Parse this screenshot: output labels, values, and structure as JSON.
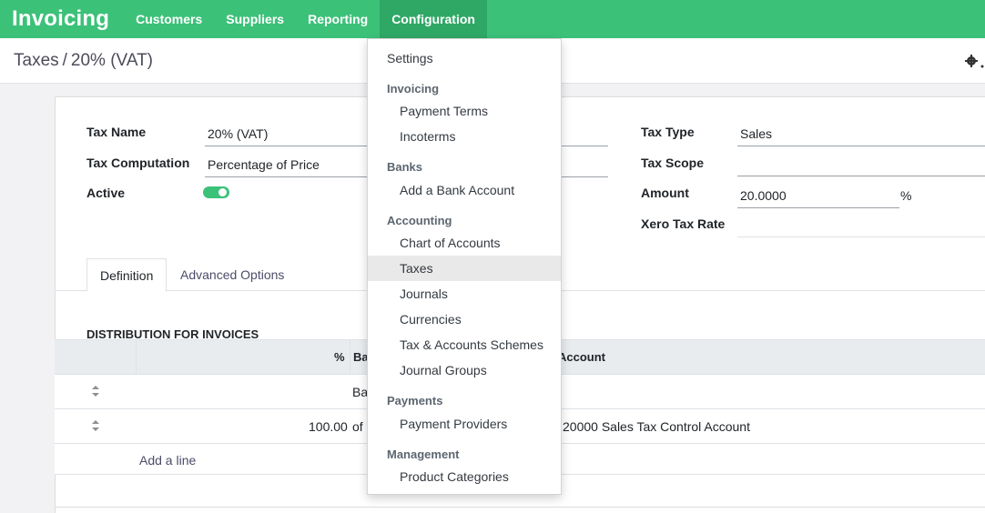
{
  "navbar": {
    "brand": "Invoicing",
    "items": [
      "Customers",
      "Suppliers",
      "Reporting",
      "Configuration"
    ]
  },
  "breadcrumb": {
    "parent": "Taxes",
    "separator": "/",
    "current": "20% (VAT)"
  },
  "form": {
    "tax_name_label": "Tax Name",
    "tax_name_value": "20% (VAT)",
    "tax_computation_label": "Tax Computation",
    "tax_computation_value": "Percentage of Price",
    "active_label": "Active",
    "tax_type_label": "Tax Type",
    "tax_type_value": "Sales",
    "tax_scope_label": "Tax Scope",
    "amount_label": "Amount",
    "amount_value": "20.0000",
    "amount_unit": "%",
    "xero_label": "Xero Tax Rate"
  },
  "tabs": {
    "definition": "Definition",
    "advanced": "Advanced Options"
  },
  "distribution": {
    "title": "DISTRIBUTION FOR INVOICES",
    "col_percent": "%",
    "col_base": "Ba",
    "col_account": "Account",
    "row1": {
      "base": "Ba"
    },
    "row2": {
      "percent": "100.00",
      "base": "of",
      "account": "20000 Sales Tax Control Account"
    },
    "add_line": "Add a line"
  },
  "dropdown": {
    "settings": "Settings",
    "invoicing_header": "Invoicing",
    "payment_terms": "Payment Terms",
    "incoterms": "Incoterms",
    "banks_header": "Banks",
    "add_bank": "Add a Bank Account",
    "accounting_header": "Accounting",
    "chart_of_accounts": "Chart of Accounts",
    "taxes": "Taxes",
    "journals": "Journals",
    "currencies": "Currencies",
    "tax_schemes": "Tax & Accounts Schemes",
    "journal_groups": "Journal Groups",
    "payments_header": "Payments",
    "payment_providers": "Payment Providers",
    "management_header": "Management",
    "product_categories": "Product Categories"
  },
  "colors": {
    "brand": "#3cc179",
    "brand_active": "#2fa866"
  }
}
